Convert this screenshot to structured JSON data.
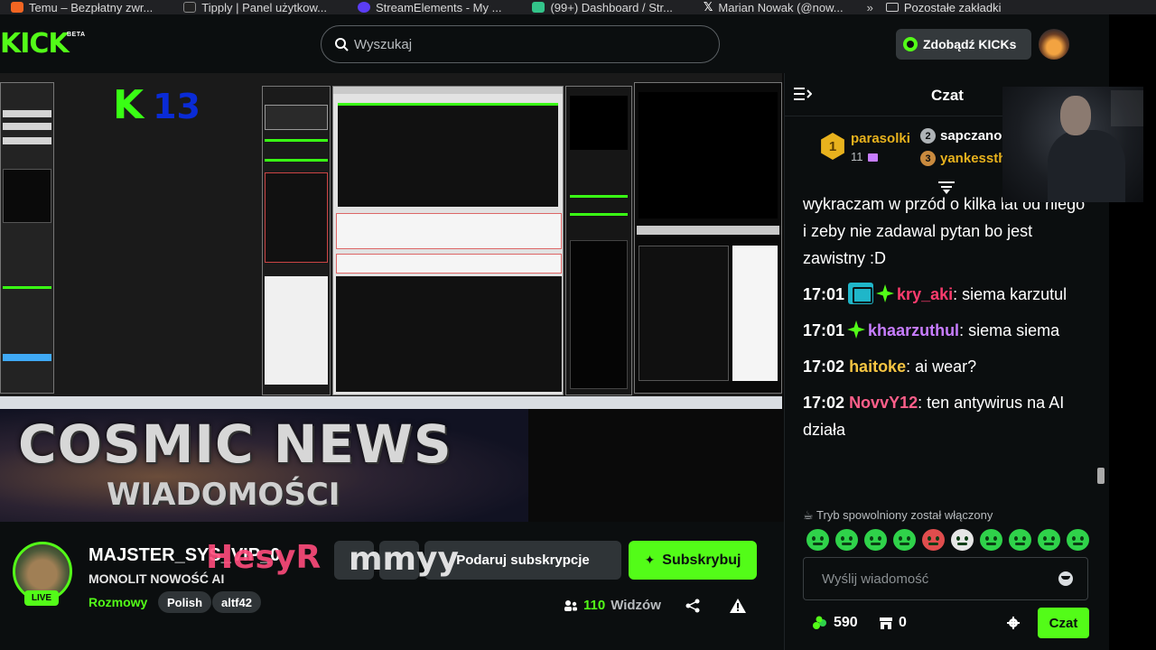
{
  "bookmarks": [
    {
      "label": "Temu – Bezpłatny zwr...",
      "color": "#f26522"
    },
    {
      "label": "Tipply | Panel użytkow...",
      "color": "#222222"
    },
    {
      "label": "StreamElements - My ...",
      "color": "#5b3df5"
    },
    {
      "label": "(99+) Dashboard / Str...",
      "color": "#33c48a"
    },
    {
      "label": "Marian Nowak (@now...",
      "color": "#111111"
    }
  ],
  "bookmarks_more": "»",
  "bookmarks_folder": "Pozostałe zakładki",
  "header": {
    "logo": "KICK",
    "logo_badge": "BETA",
    "search_placeholder": "Wyszukaj",
    "kicks_label": "Zdobądź KICKs"
  },
  "stream_screen": {
    "overlay_big": "K",
    "overlay_num": "13",
    "banner_title": "COSMIC NEWS",
    "banner_sub": "WIADOMOŚCI"
  },
  "stream_info": {
    "live_badge": "LIVE",
    "channel": "MAJSTER_SYS_VIP_0",
    "title": "MONOLIT NOWOŚĆ AI",
    "category": "Rozmowy",
    "tags": [
      "Polish",
      "altf42"
    ],
    "overlay_red": "HesyR",
    "overlay_white": "mmyy",
    "gift_label": "Podaruj subskrypcje",
    "subscribe_label": "Subskrybuj",
    "viewers_count": "110",
    "viewers_label": "Widzów"
  },
  "chat": {
    "title": "Czat",
    "leaderboard": {
      "first": {
        "rank": "1",
        "name": "parasolki",
        "count": "11"
      },
      "second": {
        "rank": "2",
        "name": "sapczano"
      },
      "third": {
        "rank": "3",
        "name": "yankessth"
      }
    },
    "messages": [
      {
        "ts": "",
        "user": "",
        "user_color": "#ffffff",
        "text": "wykraczam w przód o kilka lat od niego i zeby nie zadawal pytan bo jest zawistny :D"
      },
      {
        "ts": "17:01",
        "user": "kry_aki",
        "user_color": "#ff3c6e",
        "text": ": siema karzutul"
      },
      {
        "ts": "17:01",
        "user": "khaarzuthul",
        "user_color": "#c77dff",
        "text": ": siema siema"
      },
      {
        "ts": "17:02",
        "user": "haitoke",
        "user_color": "#f5c542",
        "text": ": ai wear?"
      },
      {
        "ts": "17:02",
        "user": "NovvY12",
        "user_color": "#ff5f8a",
        "text": ": ten antywirus na AI działa"
      }
    ],
    "slow_mode": "Tryb spowolniony został włączony",
    "input_placeholder": "Wyślij wiadomość",
    "points": "590",
    "store_count": "0",
    "send_label": "Czat"
  },
  "colors": {
    "accent": "#53fc18",
    "bg": "#0b0e0f"
  }
}
